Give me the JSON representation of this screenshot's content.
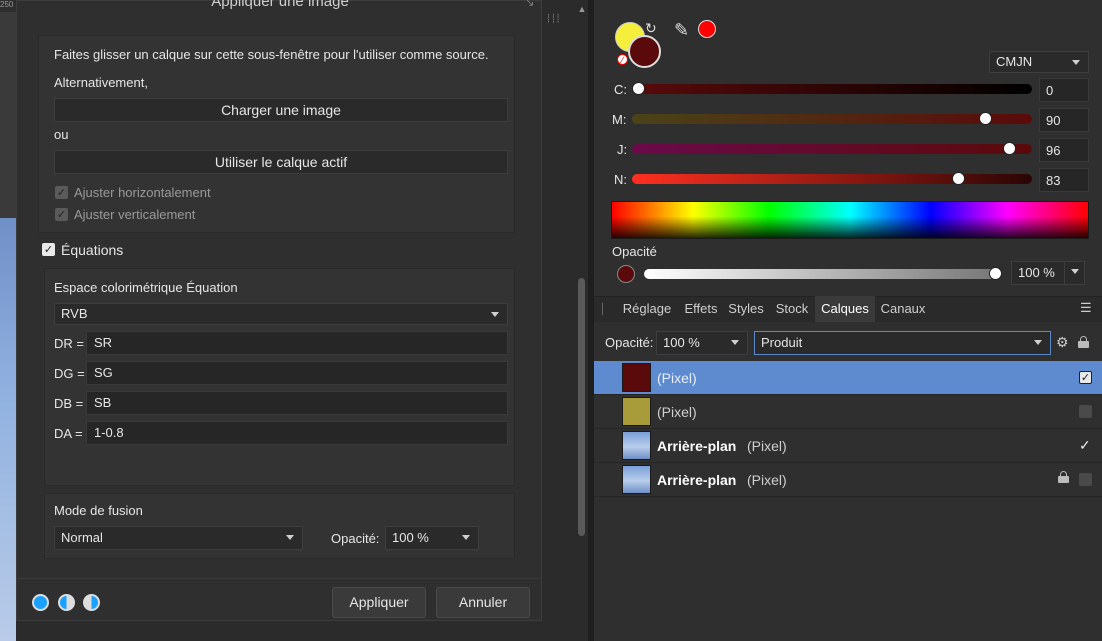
{
  "dialog": {
    "title": "Appliquer une image",
    "source_hint": "Faites glisser un calque sur cette sous-fenêtre pour l'utiliser comme source.",
    "alternatively": "Alternativement,",
    "load_image": "Charger une image",
    "or": "ou",
    "use_active_layer": "Utiliser le calque actif",
    "fit_horizontal": "Ajuster horizontalement",
    "fit_vertical": "Ajuster verticalement",
    "equations_label": "Équations",
    "equation_colorspace_label": "Espace colorimétrique Équation",
    "colorspace_value": "RVB",
    "equations": [
      {
        "label": "DR =",
        "value": "SR"
      },
      {
        "label": "DG =",
        "value": "SG"
      },
      {
        "label": "DB =",
        "value": "SB"
      },
      {
        "label": "DA =",
        "value": "1-0.8"
      }
    ],
    "blend_mode_label": "Mode de fusion",
    "blend_mode_value": "Normal",
    "opacity_label": "Opacité:",
    "opacity_value": "100 %",
    "apply": "Appliquer",
    "cancel": "Annuler"
  },
  "ruler": {
    "label": "250"
  },
  "color_panel": {
    "mode": "CMJN",
    "primary_color": "#f5ee3a",
    "secondary_color": "#5a0a0a",
    "picker_color": "#ff0000",
    "channels": [
      {
        "label": "C:",
        "value": "0",
        "level": 0.0
      },
      {
        "label": "M:",
        "value": "90",
        "level": 0.9
      },
      {
        "label": "J:",
        "value": "96",
        "level": 0.96
      },
      {
        "label": "N:",
        "value": "83",
        "level": 0.83
      }
    ],
    "opacity_label": "Opacité",
    "opacity_value": "100 %"
  },
  "tabs": [
    "Réglage",
    "Effets",
    "Styles",
    "Stock",
    "Calques",
    "Canaux"
  ],
  "active_tab": "Calques",
  "layers_panel": {
    "opacity_label": "Opacité:",
    "opacity_value": "100 %",
    "blend_value": "Produit",
    "layers": [
      {
        "name": "",
        "type": "(Pixel)",
        "selected": true,
        "checked": true,
        "thumb": "#5a0a0a"
      },
      {
        "name": "",
        "type": "(Pixel)",
        "selected": false,
        "checked": false,
        "thumb": "#a89b3a"
      },
      {
        "name": "Arrière-plan",
        "type": "(Pixel)",
        "selected": false,
        "checked": true,
        "thumb": "sky"
      },
      {
        "name": "Arrière-plan",
        "type": "(Pixel)",
        "selected": false,
        "checked": false,
        "locked": true,
        "thumb": "sky"
      }
    ]
  }
}
